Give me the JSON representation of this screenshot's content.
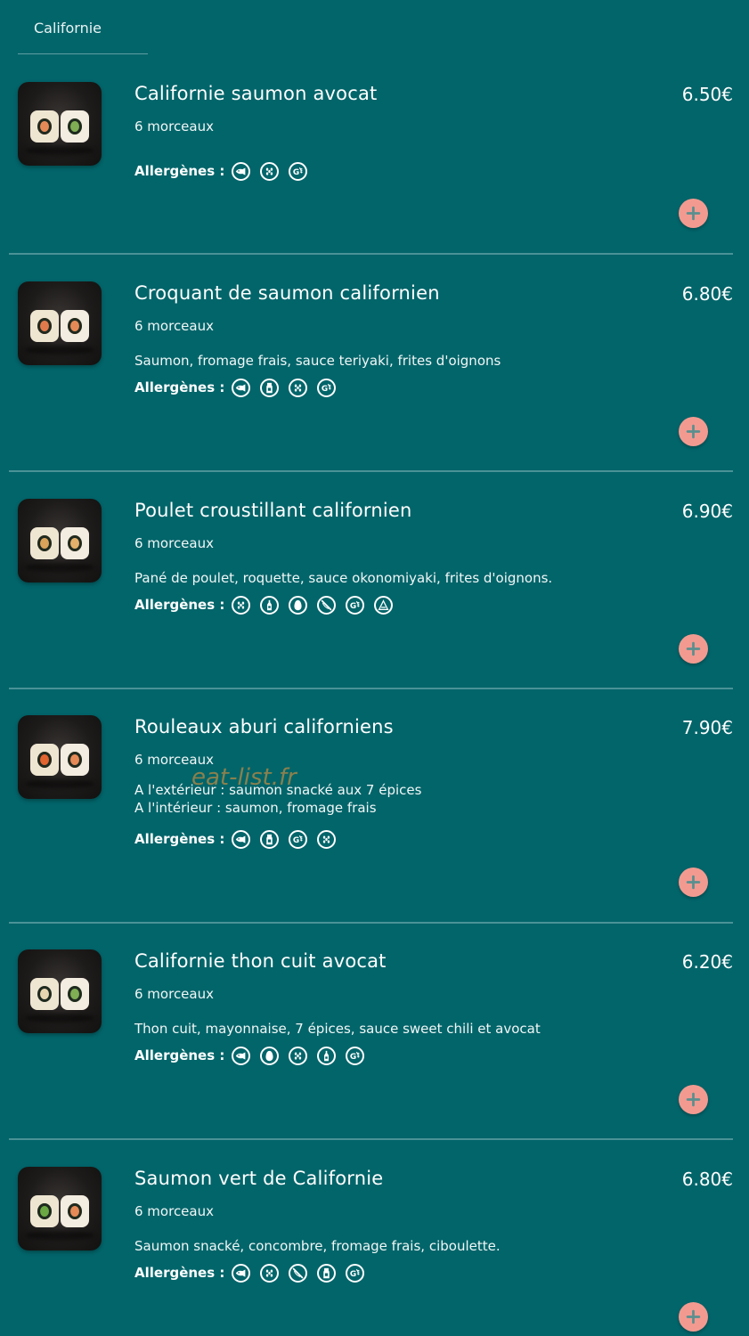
{
  "category_tab": {
    "label": "Californie"
  },
  "allergens_label": "Allergènes :",
  "watermark": "eat-list.fr",
  "colors": {
    "background": "#02656a",
    "divider": "#4a9296",
    "add_button": "#f39a90",
    "add_button_icon": "#5a8f8f"
  },
  "items": [
    {
      "title": "Californie saumon avocat",
      "price": "6.50€",
      "pieces": "6 morceaux",
      "description": [],
      "allergens": [
        "fish-icon",
        "sesame-icon",
        "gluten-icon"
      ]
    },
    {
      "title": "Croquant de saumon californien",
      "price": "6.80€",
      "pieces": "6 morceaux",
      "description": [
        "Saumon, fromage frais, sauce teriyaki, frites d'oignons"
      ],
      "allergens": [
        "fish-icon",
        "milk-icon",
        "sesame-icon",
        "gluten-icon"
      ]
    },
    {
      "title": "Poulet croustillant californien",
      "price": "6.90€",
      "pieces": "6 morceaux",
      "description": [
        "Pané de poulet, roquette, sauce okonomiyaki, frites d'oignons."
      ],
      "allergens": [
        "sesame-icon",
        "soy-icon",
        "egg-icon",
        "mustard-icon",
        "gluten-icon",
        "celery-icon"
      ]
    },
    {
      "title": "Rouleaux aburi californiens",
      "price": "7.90€",
      "pieces": "6 morceaux",
      "description": [
        "A l'extérieur : saumon snacké aux 7 épices",
        "A l'intérieur : saumon, fromage frais"
      ],
      "allergens": [
        "fish-icon",
        "milk-icon",
        "gluten-icon",
        "sesame-icon"
      ]
    },
    {
      "title": "Californie thon cuit avocat",
      "price": "6.20€",
      "pieces": "6 morceaux",
      "description": [
        "Thon cuit, mayonnaise, 7 épices, sauce sweet chili et avocat"
      ],
      "allergens": [
        "fish-icon",
        "egg-icon",
        "sesame-icon",
        "soy-icon",
        "gluten-icon"
      ]
    },
    {
      "title": "Saumon vert de Californie",
      "price": "6.80€",
      "pieces": "6 morceaux",
      "description": [
        "Saumon snacké, concombre, fromage frais, ciboulette."
      ],
      "allergens": [
        "fish-icon",
        "sesame-icon",
        "mustard-icon",
        "milk-icon",
        "gluten-icon"
      ]
    }
  ]
}
